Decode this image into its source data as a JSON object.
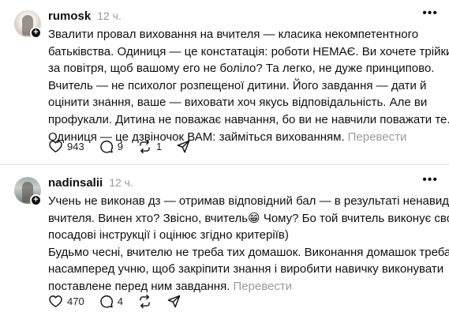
{
  "posts": [
    {
      "username": "rumosk",
      "time": "12 ч.",
      "lines": [
        "Звалити провал виховання на вчителя — класика некомпетентного",
        "батьківства. Одиниця — це констатація: роботи НЕМАЄ. Ви хочете трійки",
        "за повітря, щоб вашому его не боліло? Та легко, не дуже принципово.",
        "Вчитель — не психолог розпещеної дитини. Його завдання — дати й",
        "оцінити знання, ваше — виховати хоч якусь відповідальність. Але ви",
        "профукали. Дитина не поважає навчання, бо ви не навчили поважати те.",
        "Одиниця — це дзвіночок ВАМ: займіться вихованням."
      ],
      "translate": "Перевести",
      "likes": "943",
      "comments": "9",
      "reposts": "1"
    },
    {
      "username": "nadinsalii",
      "time": "12 ч.",
      "lines": [
        "Учень не виконав дз — отримав відповідний бал — в результаті ненавидить",
        "вчителя. Винен хто? Звісно, вчитель😁 Чому? Бо той вчитель виконує свої",
        "посадові інструкції і оцінює згідно критеріїв)",
        "Будьмо чесні, вчителю не треба тих домашок. Виконання домашок треба",
        "насамперед учню, щоб закріпити знання і виробити навичку виконувати",
        "поставлене перед ним завдання."
      ],
      "translate": "Перевести",
      "likes": "470",
      "comments": "4",
      "reposts": ""
    }
  ],
  "icons": {
    "heart": "heart-icon",
    "comment": "comment-icon",
    "repost": "repost-icon",
    "share": "send-icon",
    "more": "more-icon"
  }
}
